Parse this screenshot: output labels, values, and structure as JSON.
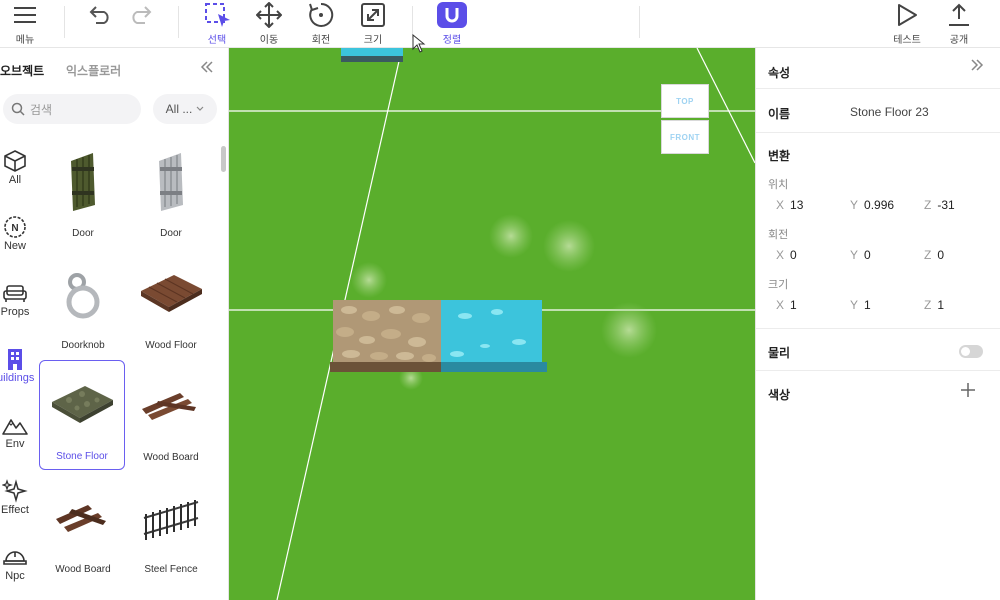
{
  "toolbar": {
    "menu": "메뉴",
    "select": "선택",
    "move": "이동",
    "rotate": "회전",
    "scale": "크기",
    "align": "정렬",
    "test": "테스트",
    "publish": "공개"
  },
  "left_panel": {
    "tab_objects": "오브젝트",
    "tab_explorer": "익스플로러",
    "search_placeholder": "검색",
    "filter_value": "All ...",
    "categories": [
      {
        "label": "All",
        "icon": "cube-icon"
      },
      {
        "label": "New",
        "icon": "new-badge-icon"
      },
      {
        "label": "Props",
        "icon": "sofa-icon"
      },
      {
        "label": "Buildings",
        "icon": "building-icon",
        "active": true
      },
      {
        "label": "Env",
        "icon": "mountain-icon"
      },
      {
        "label": "Effect",
        "icon": "sparkle-icon"
      },
      {
        "label": "Npc",
        "icon": "helmet-icon"
      }
    ],
    "items": [
      {
        "name": "Door"
      },
      {
        "name": "Door"
      },
      {
        "name": "Doorknob"
      },
      {
        "name": "Wood Floor"
      },
      {
        "name": "Stone Floor",
        "selected": true
      },
      {
        "name": "Wood Board"
      },
      {
        "name": "Wood Board"
      },
      {
        "name": "Steel Fence"
      }
    ]
  },
  "viewport": {
    "gizmo_top": "TOP",
    "gizmo_front": "FRONT"
  },
  "right_panel": {
    "title": "속성",
    "name_label": "이름",
    "name_value": "Stone Floor 23",
    "transform_label": "변환",
    "position_label": "위치",
    "position": {
      "x": "13",
      "y": "0.996",
      "z": "-31"
    },
    "rotation_label": "회전",
    "rotation": {
      "x": "0",
      "y": "0",
      "z": "0"
    },
    "scale_label": "크기",
    "scale": {
      "x": "1",
      "y": "1",
      "z": "1"
    },
    "physics_label": "물리",
    "color_label": "색상",
    "axis_x": "X",
    "axis_y": "Y",
    "axis_z": "Z"
  },
  "colors": {
    "accent": "#5b4ee8",
    "grass": "#5aae2c",
    "water": "#3cc4dc"
  }
}
